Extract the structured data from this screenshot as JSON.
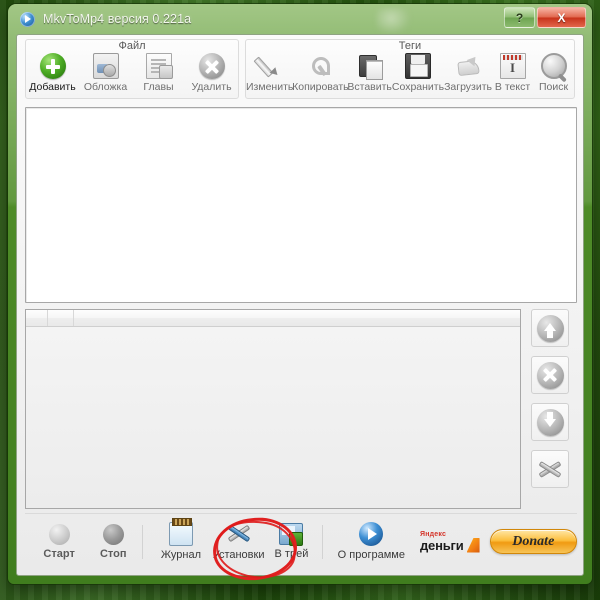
{
  "window": {
    "title": "MkvToMp4 версия 0.221a",
    "app_icon": "media-play-icon",
    "help_button": "?",
    "close_button": "X"
  },
  "ribbon": {
    "groups": [
      {
        "title": "Файл",
        "tools": [
          {
            "label": "Добавить",
            "icon": "add-circle-icon",
            "enabled": true
          },
          {
            "label": "Обложка",
            "icon": "cover-image-icon",
            "enabled": false
          },
          {
            "label": "Главы",
            "icon": "chapters-icon",
            "enabled": false
          },
          {
            "label": "Удалить",
            "icon": "delete-circle-icon",
            "enabled": false
          }
        ]
      },
      {
        "title": "Теги",
        "tools": [
          {
            "label": "Изменить",
            "icon": "pencil-icon",
            "enabled": false
          },
          {
            "label": "Копировать",
            "icon": "copy-icon",
            "enabled": false
          },
          {
            "label": "Вставить",
            "icon": "paste-icon",
            "enabled": false
          },
          {
            "label": "Сохранить",
            "icon": "floppy-save-icon",
            "enabled": false
          },
          {
            "label": "Загрузить",
            "icon": "load-arrow-icon",
            "enabled": false
          },
          {
            "label": "В текст",
            "icon": "to-text-icon",
            "enabled": false
          },
          {
            "label": "Поиск",
            "icon": "magnifier-icon",
            "enabled": false
          }
        ]
      }
    ]
  },
  "panels": {
    "top_list": {
      "items": []
    },
    "queue_list": {
      "columns": [
        "",
        "",
        ""
      ],
      "rows": []
    }
  },
  "side_buttons": [
    {
      "name": "move-up-button",
      "icon": "arrow-up-circle-icon"
    },
    {
      "name": "remove-button",
      "icon": "close-circle-icon"
    },
    {
      "name": "move-down-button",
      "icon": "arrow-down-circle-icon"
    },
    {
      "name": "settings-button",
      "icon": "tools-cross-icon"
    }
  ],
  "footer": {
    "start": {
      "label": "Старт",
      "icon": "start-dot-icon"
    },
    "stop": {
      "label": "Стоп",
      "icon": "stop-dot-icon"
    },
    "items": [
      {
        "label": "Журнал",
        "icon": "log-book-icon"
      },
      {
        "label": "Установки",
        "icon": "tools-wrench-icon"
      },
      {
        "label": "В трей",
        "icon": "tray-minimize-icon"
      },
      {
        "label": "О программе",
        "icon": "about-info-icon"
      }
    ],
    "yandex_money": {
      "top": "Яндекс",
      "bottom": "деньги",
      "icon": "yandex-money-wallet-icon"
    },
    "donate": "Donate"
  },
  "annotation": {
    "shape": "hand-drawn-red-ellipse",
    "color": "#e02020",
    "targets": "Установки"
  },
  "colors": {
    "desktop_green": "#2d6610",
    "window_frame": "#4d8a27",
    "accent_add": "#4fae26",
    "close_red": "#c8331b",
    "donate_orange": "#f09a12",
    "annotation_red": "#e02020"
  }
}
